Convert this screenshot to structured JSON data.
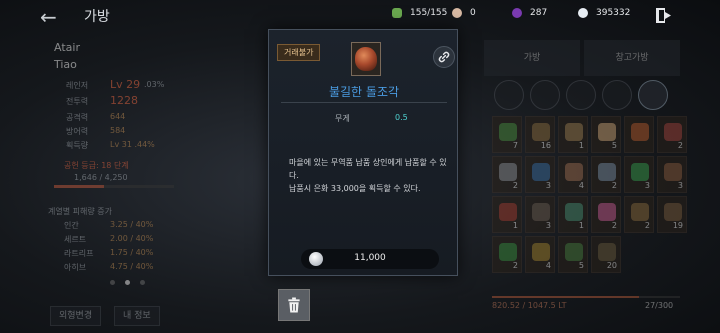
{
  "header": {
    "title": "가방"
  },
  "resources": {
    "inventory": "155/155",
    "silver_coin": "0",
    "purple_gem": "287",
    "silver": "395332"
  },
  "character": {
    "family_name": "Atair",
    "char_name": "Tiao",
    "level_label": "레인저",
    "level": "Lv 29",
    "level_pct": ".03%",
    "stats": [
      {
        "label": "전투력",
        "value": "1228"
      },
      {
        "label": "공격력",
        "value": "644"
      },
      {
        "label": "방어력",
        "value": "584"
      },
      {
        "label": "획득량",
        "value": "Lv 31 .44%"
      }
    ],
    "grade": "공헌 등급: 18 단계",
    "grade_progress": "1,646 / 4,250",
    "grade_progress_fraction": 0.42,
    "damage_title": "계열별 피해량 증가",
    "damage": [
      {
        "label": "인간",
        "value": "3.25 / 40%"
      },
      {
        "label": "세르트",
        "value": "2.00 / 40%"
      },
      {
        "label": "라트리프",
        "value": "1.75 / 40%"
      },
      {
        "label": "아히브",
        "value": "4.75 / 40%"
      }
    ],
    "btn_appearance": "외형변경",
    "btn_info": "내 정보"
  },
  "inventory": {
    "tab_bag": "가방",
    "tab_storage": "창고가방",
    "slots": [
      {
        "q": "7",
        "color": "#4a8a3a"
      },
      {
        "q": "16",
        "color": "#8a6a3a"
      },
      {
        "q": "1",
        "color": "#9a7a4a"
      },
      {
        "q": "5",
        "color": "#c9a070"
      },
      {
        "q": "",
        "color": "#b35a2a"
      },
      {
        "q": "2",
        "color": "#a0443a"
      },
      {
        "q": "2",
        "color": "#8a8a8a"
      },
      {
        "q": "3",
        "color": "#3a6a9a"
      },
      {
        "q": "4",
        "color": "#9a6a4a"
      },
      {
        "q": "2",
        "color": "#7a8a9a"
      },
      {
        "q": "3",
        "color": "#3a9a4a"
      },
      {
        "q": "3",
        "color": "#8a5a3a"
      },
      {
        "q": "1",
        "color": "#a03a2a"
      },
      {
        "q": "3",
        "color": "#6a5a4a"
      },
      {
        "q": "1",
        "color": "#4a8a6a"
      },
      {
        "q": "2",
        "color": "#c45a8a"
      },
      {
        "q": "2",
        "color": "#8a6a3a"
      },
      {
        "q": "19",
        "color": "#7a5a3a"
      },
      {
        "q": "2",
        "color": "#3a8a3a"
      },
      {
        "q": "4",
        "color": "#a0802a"
      },
      {
        "q": "5",
        "color": "#4a7a3a"
      },
      {
        "q": "20",
        "color": "#6a5a3a"
      }
    ],
    "weight": "820.52 / 1047.5 LT",
    "weight_fraction": 0.78,
    "capacity": "27/300"
  },
  "popup": {
    "badge": "거래불가",
    "item_name": "불길한 돌조각",
    "stat_label": "무게",
    "stat_value": "0.5",
    "desc_line1": "마을에 있는 무역품 납품 상인에게 납품할 수 있다.",
    "desc_line2": "납품시 은화 33,000을 획득할 수 있다.",
    "price": "11,000"
  },
  "colors": {
    "item_name": "#4a9be0",
    "stat_value": "#4fd1d1",
    "accent_red": "#d9603e"
  }
}
